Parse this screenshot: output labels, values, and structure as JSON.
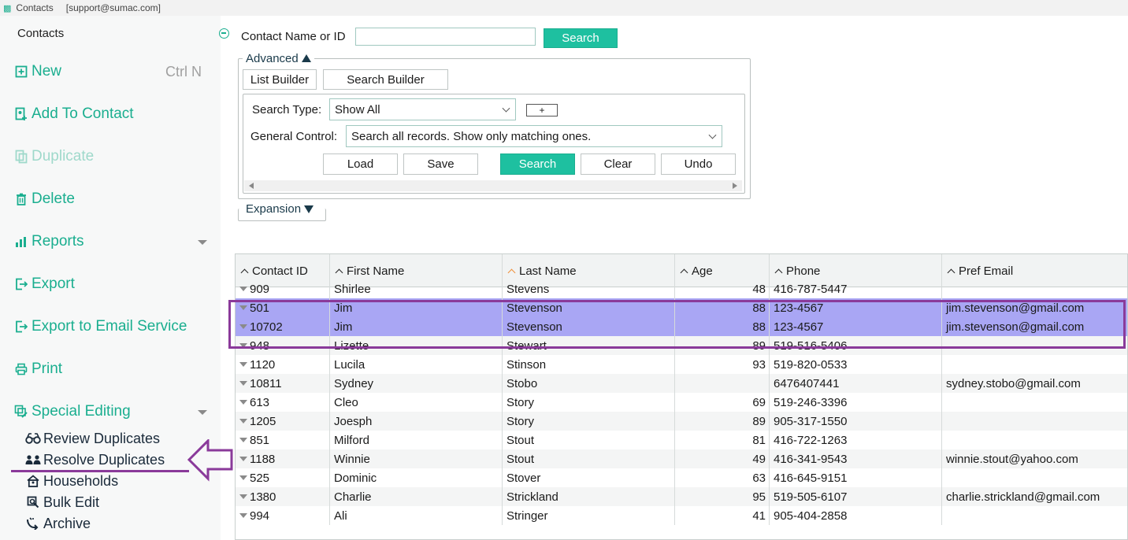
{
  "titlebar": {
    "app": "Contacts",
    "user": "[support@sumac.com]"
  },
  "sidebar": {
    "title": "Contacts",
    "new": {
      "label": "New",
      "shortcut": "Ctrl N"
    },
    "add_to_contact": "Add To Contact",
    "duplicate": "Duplicate",
    "delete": "Delete",
    "reports": "Reports",
    "export": "Export",
    "export_email": "Export to Email Service",
    "print": "Print",
    "special_editing": "Special Editing",
    "sub": {
      "review_duplicates": "Review Duplicates",
      "resolve_duplicates": "Resolve Duplicates",
      "households": "Households",
      "bulk_edit": "Bulk Edit",
      "archive": "Archive"
    }
  },
  "search": {
    "label": "Contact Name or ID",
    "value": "",
    "button": "Search"
  },
  "advanced": {
    "legend": "Advanced",
    "tabs": {
      "list_builder": "List Builder",
      "search_builder": "Search Builder"
    },
    "search_type_label": "Search Type:",
    "search_type_value": "Show All",
    "plus_button": "+",
    "general_control_label": "General Control:",
    "general_control_value": "Search all records. Show only matching ones.",
    "buttons": {
      "load": "Load",
      "save": "Save",
      "search": "Search",
      "clear": "Clear",
      "undo": "Undo"
    }
  },
  "expansion": {
    "legend": "Expansion"
  },
  "table": {
    "columns": [
      "Contact ID",
      "First Name",
      "Last Name",
      "Age",
      "Phone",
      "Pref Email"
    ],
    "rows": [
      {
        "id": "909",
        "first": "Shirlee",
        "last": "Stevens",
        "age": "48",
        "phone": "416-787-5447",
        "email": ""
      },
      {
        "id": "501",
        "first": "Jim",
        "last": "Stevenson",
        "age": "88",
        "phone": "123-4567",
        "email": "jim.stevenson@gmail.com"
      },
      {
        "id": "10702",
        "first": "Jim",
        "last": "Stevenson",
        "age": "88",
        "phone": "123-4567",
        "email": "jim.stevenson@gmail.com"
      },
      {
        "id": "948",
        "first": "Lizette",
        "last": "Stewart",
        "age": "89",
        "phone": "519-516-5406",
        "email": ""
      },
      {
        "id": "1120",
        "first": "Lucila",
        "last": "Stinson",
        "age": "93",
        "phone": "519-820-0533",
        "email": ""
      },
      {
        "id": "10811",
        "first": "Sydney",
        "last": "Stobo",
        "age": "",
        "phone": "6476407441",
        "email": "sydney.stobo@gmail.com"
      },
      {
        "id": "613",
        "first": "Cleo",
        "last": "Story",
        "age": "69",
        "phone": "519-246-3396",
        "email": ""
      },
      {
        "id": "1205",
        "first": "Joesph",
        "last": "Story",
        "age": "89",
        "phone": "905-317-1550",
        "email": ""
      },
      {
        "id": "851",
        "first": "Milford",
        "last": "Stout",
        "age": "81",
        "phone": "416-722-1263",
        "email": ""
      },
      {
        "id": "1188",
        "first": "Winnie",
        "last": "Stout",
        "age": "49",
        "phone": "416-341-9543",
        "email": "winnie.stout@yahoo.com"
      },
      {
        "id": "525",
        "first": "Dominic",
        "last": "Stover",
        "age": "63",
        "phone": "416-645-9151",
        "email": ""
      },
      {
        "id": "1380",
        "first": "Charlie",
        "last": "Strickland",
        "age": "95",
        "phone": "519-505-6107",
        "email": "charlie.strickland@gmail.com"
      },
      {
        "id": "994",
        "first": "Ali",
        "last": "Stringer",
        "age": "41",
        "phone": "905-404-2858",
        "email": ""
      }
    ]
  },
  "colors": {
    "accent": "#1ec0a0",
    "selection": "#a9a6f4",
    "annotation": "#8a3a9a"
  }
}
